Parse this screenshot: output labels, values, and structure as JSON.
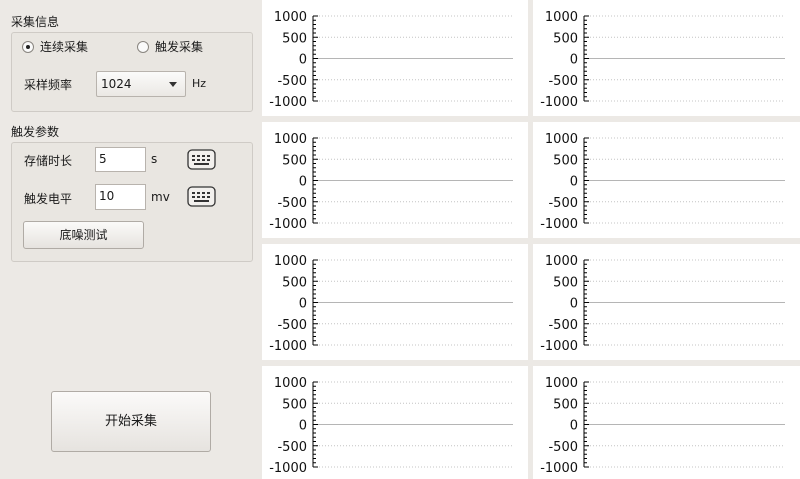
{
  "acquisition": {
    "title": "采集信息",
    "mode_continuous": "连续采集",
    "mode_trigger": "触发采集",
    "selected_mode": "continuous",
    "sample_rate_label": "采样频率",
    "sample_rate_value": "1024",
    "sample_rate_unit": "Hz"
  },
  "trigger": {
    "title": "触发参数",
    "storage_time_label": "存储时长",
    "storage_time_value": "5",
    "storage_time_unit": "s",
    "trigger_level_label": "触发电平",
    "trigger_level_value": "10",
    "trigger_level_unit": "mv",
    "noise_test_button": "底噪测试"
  },
  "start_button": "开始采集",
  "chart_data": {
    "type": "line",
    "plots": 8,
    "ylim": [
      -1000,
      1000
    ],
    "yticks": [
      "1000",
      "500",
      "0",
      "-500",
      "-1000"
    ],
    "series": [],
    "grid": "dotted horizontal"
  }
}
